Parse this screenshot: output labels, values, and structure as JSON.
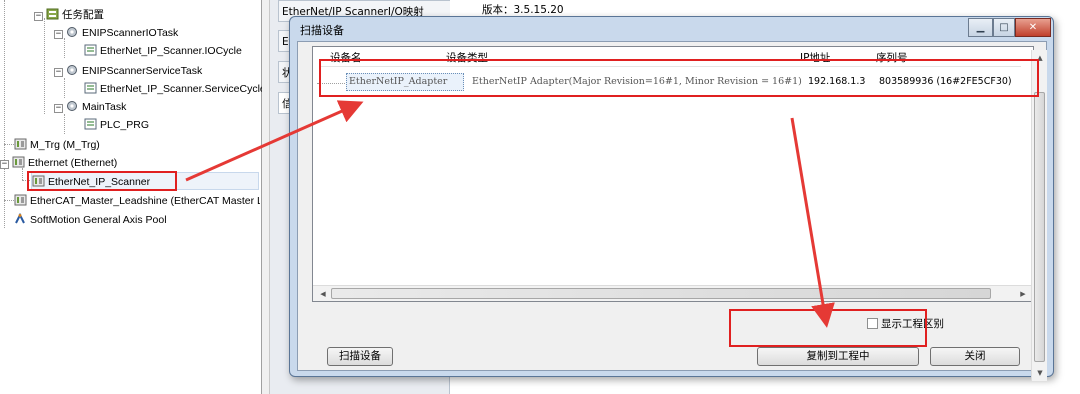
{
  "tree": {
    "items": [
      {
        "label": "任务配置",
        "icon": "task-config-icon"
      },
      {
        "label": "ENIPScannerIOTask",
        "icon": "task-icon"
      },
      {
        "label": "EtherNet_IP_Scanner.IOCycle",
        "icon": "program-call-icon"
      },
      {
        "label": "ENIPScannerServiceTask",
        "icon": "task-icon"
      },
      {
        "label": "EtherNet_IP_Scanner.ServiceCycle",
        "icon": "program-call-icon"
      },
      {
        "label": "MainTask",
        "icon": "task-icon"
      },
      {
        "label": "PLC_PRG",
        "icon": "program-call-icon"
      },
      {
        "label": "M_Trg (M_Trg)",
        "icon": "device-icon"
      },
      {
        "label": "Ethernet (Ethernet)",
        "icon": "device-icon"
      },
      {
        "label": "EtherNet_IP_Scanner",
        "icon": "device-icon"
      },
      {
        "label": "EtherCAT_Master_Leadshine (EtherCAT Master Leadsh",
        "icon": "device-icon"
      },
      {
        "label": "SoftMotion General Axis Pool",
        "icon": "axis-pool-icon"
      }
    ]
  },
  "editor_tabs": [
    "EtherNet/IP ScannerI/O映射",
    "Et",
    "状",
    "信"
  ],
  "info": {
    "version_label": "版本：",
    "version_value": "3.5.15.20"
  },
  "dialog": {
    "title": "扫描设备",
    "columns": [
      "设备名",
      "设备类型",
      "IP地址",
      "序列号"
    ],
    "rows": [
      {
        "name": "EtherNetIP_Adapter",
        "type": "EtherNetIP Adapter(Major Revision=16#1, Minor Revision = 16#1)",
        "ip": "192.168.1.3",
        "serial": "803589936  (16#2FE5CF30)"
      }
    ],
    "show_diff_label": "显示工程区别",
    "scan_button": "扫描设备",
    "copy_button": "复制到工程中",
    "close_button": "关闭"
  },
  "colors": {
    "highlight": "#e02020",
    "dialog_frame": "#c9d9ec"
  }
}
